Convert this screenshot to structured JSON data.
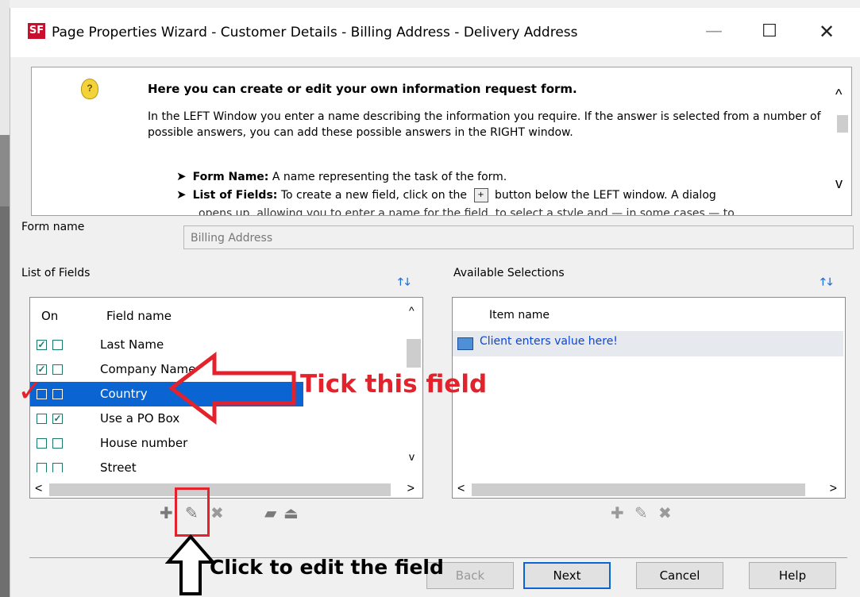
{
  "window": {
    "app_logo": "SF",
    "title": "Page Properties Wizard - Customer Details - Billing Address - Delivery Address",
    "minimize": "—",
    "maximize": "☐",
    "close": "✕"
  },
  "help": {
    "heading": "Here you can create or edit your own information request form.",
    "paragraph": "In the LEFT Window you enter a name describing the information you require. If the answer is selected from a number of possible answers, you can add these possible answers in the RIGHT window.",
    "bullets": [
      {
        "term": "Form Name:",
        "text": "A name representing the task of the form."
      },
      {
        "term": "List of Fields:",
        "text_before": "To create a new field, click on the",
        "text_after": "button below the LEFT window. A dialog"
      }
    ],
    "clipped_line": "opens up, allowing you to enter a name for the field, to select a style and — in some cases — to"
  },
  "form": {
    "name_label": "Form name",
    "name_value": "Billing Address"
  },
  "fields": {
    "label": "List of Fields",
    "columns": {
      "on": "On",
      "name": "Field name"
    },
    "rows": [
      {
        "name": "Last Name",
        "c1": true,
        "c2": false,
        "selected": false
      },
      {
        "name": "Company Name",
        "c1": true,
        "c2": false,
        "selected": false
      },
      {
        "name": "Country",
        "c1": false,
        "c2": false,
        "selected": true
      },
      {
        "name": "Use a PO Box",
        "c1": false,
        "c2": true,
        "selected": false
      },
      {
        "name": "House number",
        "c1": false,
        "c2": false,
        "selected": false
      },
      {
        "name": "Street",
        "c1": false,
        "c2": false,
        "selected": false
      }
    ]
  },
  "selections": {
    "label": "Available Selections",
    "column": "Item name",
    "items": [
      "Client enters value here!"
    ]
  },
  "buttons": {
    "back": "Back",
    "next": "Next",
    "cancel": "Cancel",
    "help": "Help"
  },
  "annotations": {
    "tick": "Tick this field",
    "edit": "Click to edit the field",
    "color": "#e4222b"
  },
  "colors": {
    "selection": "#0a64d2",
    "link": "#0b46d6",
    "sort_arrow": "#1f6fd6"
  }
}
